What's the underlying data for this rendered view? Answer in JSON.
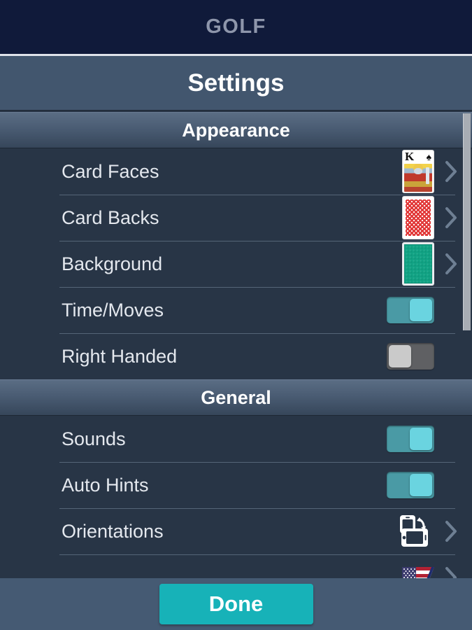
{
  "appbar": {
    "title": "GOLF"
  },
  "titlebar": {
    "title": "Settings"
  },
  "sections": [
    {
      "id": "appearance",
      "header": "Appearance",
      "rows": [
        {
          "label": "Card Faces",
          "accessory": "card-face-thumb",
          "icon_name": "king-of-spades-card-icon",
          "chevron": true
        },
        {
          "label": "Card Backs",
          "accessory": "card-back-thumb",
          "icon_name": "red-card-back-icon",
          "chevron": true
        },
        {
          "label": "Background",
          "accessory": "background-swatch",
          "icon_name": "green-felt-swatch-icon",
          "chevron": true
        },
        {
          "label": "Time/Moves",
          "accessory": "toggle",
          "icon_name": "toggle-switch",
          "state": "on"
        },
        {
          "label": "Right Handed",
          "accessory": "toggle",
          "icon_name": "toggle-switch",
          "state": "off"
        }
      ]
    },
    {
      "id": "general",
      "header": "General",
      "rows": [
        {
          "label": "Sounds",
          "accessory": "toggle",
          "icon_name": "toggle-switch",
          "state": "on"
        },
        {
          "label": "Auto Hints",
          "accessory": "toggle",
          "icon_name": "toggle-switch",
          "state": "on"
        },
        {
          "label": "Orientations",
          "accessory": "orient-icon",
          "icon_name": "device-rotation-icon",
          "chevron": true
        },
        {
          "label": "",
          "accessory": "flag",
          "icon_name": "us-flag-icon",
          "chevron": true
        }
      ]
    }
  ],
  "card_face": {
    "rank": "K",
    "suit": "♠"
  },
  "bottombar": {
    "done_label": "Done"
  },
  "colors": {
    "appbar_bg": "#101a3a",
    "appbar_text": "#8e96ab",
    "titlebar_bg": "#42566e",
    "list_bg": "#283546",
    "separator": "#556577",
    "toggle_on_track": "#4a9aa5",
    "toggle_on_knob": "#6ad4e0",
    "toggle_off_track": "#5f6063",
    "toggle_off_knob": "#cacaca",
    "done_button": "#17b2b8",
    "bottombar_bg": "#455a73",
    "card_back_red": "#e23b3b",
    "background_green": "#11a384",
    "scrollbar_thumb": "#a8adb4"
  }
}
